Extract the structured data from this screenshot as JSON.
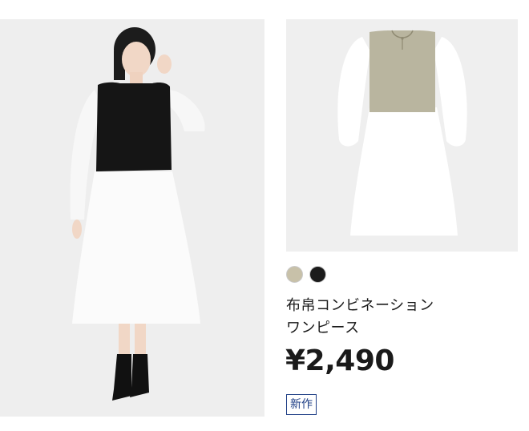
{
  "images": {
    "model_photo_icon": "model-photo-image",
    "product_photo_icon": "product-photo-image"
  },
  "product": {
    "colors": [
      {
        "name": "beige",
        "hex": "#c8c1a9"
      },
      {
        "name": "black",
        "hex": "#1b1b1b"
      }
    ],
    "name_line1": "布帛コンビネーション",
    "name_line2": "ワンピース",
    "price": "¥2,490",
    "badge": "新作"
  },
  "theme": {
    "badge_color": "#1f3f86",
    "photo_background": "#efefef"
  }
}
